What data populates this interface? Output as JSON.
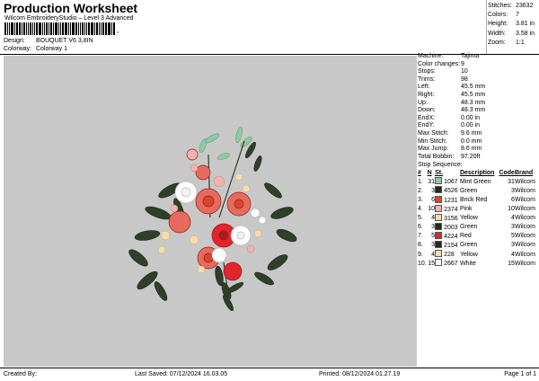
{
  "header": {
    "title": "Production Worksheet",
    "subtitle": "Wilcom EmbroideryStudio – Level 3 Advanced",
    "design_label": "Design:",
    "design_value": "BOUQUET V6 3,8IN",
    "colorway_label": "Colorway:",
    "colorway_value": "Colorway 1"
  },
  "summary": {
    "stitches_label": "Stitches:",
    "stitches_value": "23632",
    "colors_label": "Colors:",
    "colors_value": "7",
    "height_label": "Height:",
    "height_value": "3.81 in",
    "width_label": "Width:",
    "width_value": "3.58 in",
    "zoom_label": "Zoom:",
    "zoom_value": "1:1"
  },
  "machine_info": [
    {
      "label": "Machine:",
      "value": "Tajima"
    },
    {
      "label": "Color changes:",
      "value": "9"
    },
    {
      "label": "Stops:",
      "value": "10"
    },
    {
      "label": "Trims:",
      "value": "98"
    },
    {
      "label": "Left:",
      "value": "45.5 mm"
    },
    {
      "label": "Right:",
      "value": "45.5 mm"
    },
    {
      "label": "Up:",
      "value": "48.3 mm"
    },
    {
      "label": "Down:",
      "value": "48.3 mm"
    },
    {
      "label": "EndX:",
      "value": "0.00 in"
    },
    {
      "label": "EndY:",
      "value": "0.00 in"
    },
    {
      "label": "Max Stitch:",
      "value": "9.6 mm"
    },
    {
      "label": "Min Stitch:",
      "value": "0.0 mm"
    },
    {
      "label": "Max Jump:",
      "value": "8.6 mm"
    },
    {
      "label": "Total Bobbin:",
      "value": "97.20ft"
    }
  ],
  "stop_sequence": {
    "label": "Stop Sequence:",
    "headers": [
      "#",
      "N",
      "St.",
      "Description",
      "Code",
      "Brand"
    ],
    "rows": [
      {
        "num": "1.",
        "n": "31",
        "color": "#8fc9a3",
        "st": "1067",
        "desc": "Mint Green",
        "code": "31",
        "brand": "Wilcom"
      },
      {
        "num": "2.",
        "n": "3",
        "color": "#1e2b1e",
        "st": "4526",
        "desc": "Green",
        "code": "3",
        "brand": "Wilcom"
      },
      {
        "num": "3.",
        "n": "6",
        "color": "#d9462e",
        "st": "1231",
        "desc": "Brick Red",
        "code": "6",
        "brand": "Wilcom"
      },
      {
        "num": "4.",
        "n": "10",
        "color": "#f0b3b0",
        "st": "2374",
        "desc": "Pink",
        "code": "10",
        "brand": "Wilcom"
      },
      {
        "num": "5.",
        "n": "4",
        "color": "#f3dcae",
        "st": "3156",
        "desc": "Yellow",
        "code": "4",
        "brand": "Wilcom"
      },
      {
        "num": "6.",
        "n": "3",
        "color": "#1e2b1e",
        "st": "2003",
        "desc": "Green",
        "code": "3",
        "brand": "Wilcom"
      },
      {
        "num": "7.",
        "n": "5",
        "color": "#e2242c",
        "st": "4224",
        "desc": "Red",
        "code": "5",
        "brand": "Wilcom"
      },
      {
        "num": "8.",
        "n": "3",
        "color": "#1e2b1e",
        "st": "2154",
        "desc": "Green",
        "code": "3",
        "brand": "Wilcom"
      },
      {
        "num": "9.",
        "n": "4",
        "color": "#f3dcae",
        "st": "228",
        "desc": "Yellow",
        "code": "4",
        "brand": "Wilcom"
      },
      {
        "num": "10.",
        "n": "15",
        "color": "#ffffff",
        "st": "2667",
        "desc": "White",
        "code": "15",
        "brand": "Wilcom"
      }
    ]
  },
  "footer": {
    "created_by": "Created By:",
    "last_saved": "Last Saved: 07/12/2024 16.03.05",
    "printed": "Printed: 08/12/2024 01.27.19",
    "page": "Page 1 of 1"
  },
  "colors": {
    "canvas_bg": "#c8c8c8",
    "leaf_dark": "#2f3f2a",
    "leaf_mint": "#8fc9a3",
    "rose_red": "#e2242c",
    "rose_coral": "#e86a5e",
    "rose_white": "#ffffff",
    "petal_yellow": "#f3dcae",
    "petal_pink": "#f0b3b0"
  }
}
